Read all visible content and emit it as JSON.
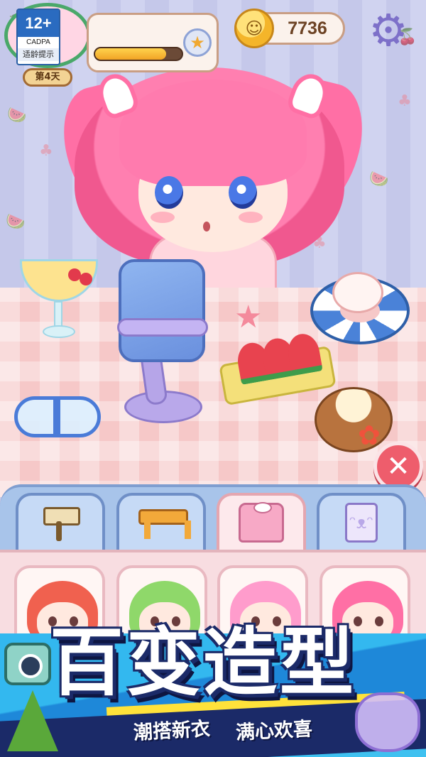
{
  "hud": {
    "age_rating": {
      "number": "12+",
      "org": "CADPA",
      "tip": "适龄提示"
    },
    "day_label": "第4天",
    "xp_progress": 0.82,
    "coins": "7736"
  },
  "tabs": [
    {
      "icon": "paint-roller-icon",
      "active": false
    },
    {
      "icon": "stool-icon",
      "active": false
    },
    {
      "icon": "shirt-icon",
      "active": true
    },
    {
      "icon": "bunny-card-icon",
      "active": false
    }
  ],
  "outfits": [
    {
      "hair_color": "#f0614f"
    },
    {
      "hair_color": "#8fd86a"
    },
    {
      "hair_color": "#ff9ccc"
    },
    {
      "hair_color": "#ff6fa5"
    }
  ],
  "promo": {
    "title": "百变造型",
    "subtitle_left": "潮搭新衣",
    "subtitle_right": "满心欢喜"
  }
}
